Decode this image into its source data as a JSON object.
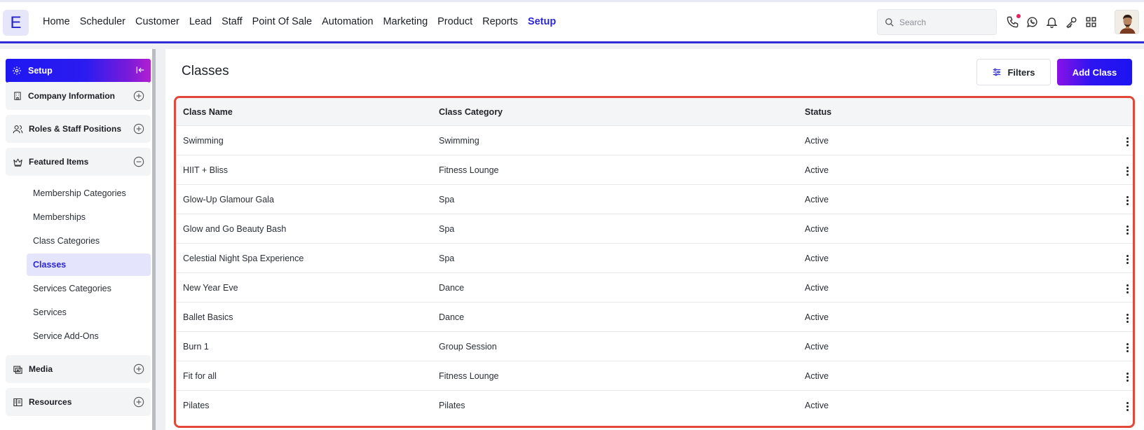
{
  "app": {
    "logo_letter": "E"
  },
  "nav": {
    "items": [
      "Home",
      "Scheduler",
      "Customer",
      "Lead",
      "Staff",
      "Point Of Sale",
      "Automation",
      "Marketing",
      "Product",
      "Reports",
      "Setup"
    ],
    "active": "Setup"
  },
  "search": {
    "placeholder": "Search",
    "value": ""
  },
  "top_icons": [
    "phone-icon",
    "whatsapp-icon",
    "bell-icon",
    "key-icon",
    "grid-icon"
  ],
  "sidebar": {
    "header": "Setup",
    "sections": [
      {
        "label": "Company Information",
        "icon": "building-icon",
        "expanded": false
      },
      {
        "label": "Roles & Staff Positions",
        "icon": "users-icon",
        "expanded": false
      },
      {
        "label": "Featured Items",
        "icon": "crown-icon",
        "expanded": true
      },
      {
        "label": "Media",
        "icon": "media-icon",
        "expanded": false
      },
      {
        "label": "Resources",
        "icon": "resources-icon",
        "expanded": false
      }
    ],
    "featured_items": [
      "Membership Categories",
      "Memberships",
      "Class Categories",
      "Classes",
      "Services Categories",
      "Services",
      "Service Add-Ons"
    ],
    "active_item": "Classes"
  },
  "main": {
    "title": "Classes",
    "filters_label": "Filters",
    "add_label": "Add Class"
  },
  "table": {
    "columns": [
      "Class Name",
      "Class Category",
      "Status"
    ],
    "rows": [
      [
        "Swimming",
        "Swimming",
        "Active"
      ],
      [
        "HIIT + Bliss",
        "Fitness Lounge",
        "Active"
      ],
      [
        "Glow-Up Glamour Gala",
        "Spa",
        "Active"
      ],
      [
        "Glow and Go Beauty Bash",
        "Spa",
        "Active"
      ],
      [
        "Celestial Night Spa Experience",
        "Spa",
        "Active"
      ],
      [
        "New Year Eve",
        "Dance",
        "Active"
      ],
      [
        "Ballet Basics",
        "Dance",
        "Active"
      ],
      [
        "Burn 1",
        "Group Session",
        "Active"
      ],
      [
        "Fit for all",
        "Fitness Lounge",
        "Active"
      ],
      [
        "Pilates",
        "Pilates",
        "Active"
      ]
    ]
  },
  "colors": {
    "accent": "#2b27d3",
    "highlight_border": "#e2483a",
    "notification_dot": "#e0245e"
  }
}
